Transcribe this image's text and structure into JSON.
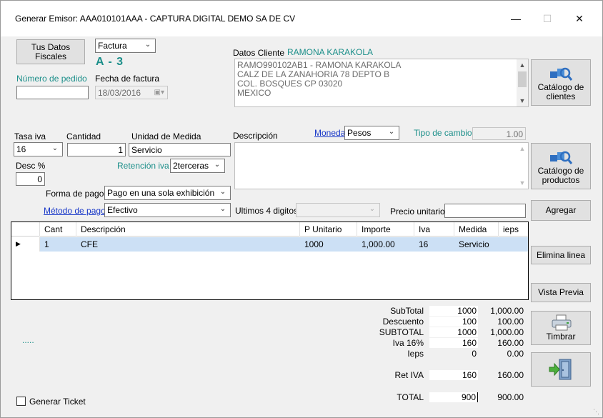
{
  "window": {
    "title": "Generar   Emisor: AAA010101AAA  -  CAPTURA DIGITAL DEMO SA DE CV",
    "minimize_glyph": "—",
    "maximize_glyph": "☐",
    "close_glyph": "✕"
  },
  "header": {
    "datos_fiscales_button": "Tus Datos Fiscales",
    "doc_type": "Factura",
    "serie_folio": "A - 3",
    "numero_pedido_label": "Número de pedido",
    "numero_pedido_value": "",
    "fecha_factura_label": "Fecha de factura",
    "fecha_factura_value": "18/03/2016"
  },
  "cliente": {
    "label": "Datos Cliente",
    "name": "RAMONA KARAKOLA",
    "address_lines": [
      "RAMO990102AB1  -  RAMONA KARAKOLA",
      "CALZ DE LA ZANAHORIA 78 DEPTO B",
      "COL. BOSQUES   CP 03020",
      "MEXICO"
    ],
    "catalogo_button": "Catálogo de clientes"
  },
  "concepto": {
    "tasa_iva_label": "Tasa iva",
    "tasa_iva_value": "16",
    "cantidad_label": "Cantidad",
    "cantidad_value": "1",
    "unidad_label": "Unidad de Medida",
    "unidad_value": "Servicio",
    "descripcion_label": "Descripción",
    "descripcion_value": "",
    "moneda_label": "Moneda",
    "moneda_value": "Pesos",
    "tipo_cambio_label": "Tipo de cambio",
    "tipo_cambio_value": "1.00",
    "desc_label": "Desc %",
    "desc_value": "0",
    "retencion_label": "Retención iva",
    "retencion_value": "2terceras",
    "forma_pago_label": "Forma de pago",
    "forma_pago_value": "Pago en una sola exhibición",
    "metodo_pago_label": "Método de pago",
    "metodo_pago_value": "Efectivo",
    "ultimos4_label": "Ultimos 4 digitos",
    "ultimos4_value": "",
    "precio_unitario_label": "Precio unitario",
    "precio_unitario_value": "",
    "catalogo_productos_button": "Catálogo de productos",
    "agregar_button": "Agregar"
  },
  "grid": {
    "columns": [
      "Cant",
      "Descripción",
      "P Unitario",
      "Importe",
      "Iva",
      "Medida",
      "ieps"
    ],
    "rows": [
      {
        "cant": "1",
        "descripcion": "CFE",
        "p_unitario": "1000",
        "importe": "1,000.00",
        "iva": "16",
        "medida": "Servicio",
        "ieps": ""
      }
    ],
    "row_indicator": "▶"
  },
  "side_buttons": {
    "elimina_linea": "Elimina linea",
    "vista_previa": "Vista Previa",
    "timbrar": "Timbrar"
  },
  "totals": {
    "subtotal_label": "SubTotal",
    "subtotal_box": "1000",
    "subtotal_val": "1,000.00",
    "descuento_label": "Descuento",
    "descuento_box": "100",
    "descuento_val": "100.00",
    "subtotal2_label": "SUBTOTAL",
    "subtotal2_box": "1000",
    "subtotal2_val": "1,000.00",
    "iva_label": "Iva 16%",
    "iva_box": "160",
    "iva_val": "160.00",
    "ieps_label": "Ieps",
    "ieps_box": "0",
    "ieps_val": "0.00",
    "retiva_label": "Ret IVA",
    "retiva_box": "160",
    "retiva_val": "160.00",
    "total_label": "TOTAL",
    "total_box": "900",
    "total_val": "900.00"
  },
  "footer": {
    "dots": ".....",
    "generar_ticket_label": "Generar Ticket"
  }
}
